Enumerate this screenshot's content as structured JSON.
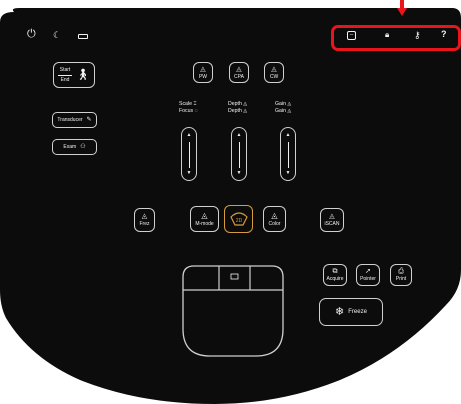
{
  "status_bar": {
    "icons": [
      "power-icon",
      "moon-icon",
      "battery-icon"
    ]
  },
  "system_icons": [
    "minimize-icon",
    "lock-icon",
    "settings-wrench-icon",
    "help-icon"
  ],
  "highlight_color": "#e8151b",
  "accent_color": "#d89b3c",
  "start_end": {
    "start_label": "Start",
    "end_label": "End"
  },
  "transducer_label": "Transducer",
  "exam_label": "Exam",
  "mode_top": {
    "pw": "PW",
    "cpa": "CPA",
    "cw": "CW"
  },
  "adjust": {
    "scale_label": "Scale",
    "focus_label": "Focus",
    "depth_label_1": "Depth",
    "depth_label_2": "Depth",
    "gain_label_1": "Gain",
    "gain_label_2": "Gain"
  },
  "modes": {
    "freeze_small": "Frez",
    "mmode": "M-mode",
    "twod": "2D",
    "color": "Color",
    "iscan": "iSCAN"
  },
  "actions": {
    "acquire": "Acquire",
    "pointer": "Pointer",
    "print": "Print",
    "freeze": "Freeze"
  }
}
